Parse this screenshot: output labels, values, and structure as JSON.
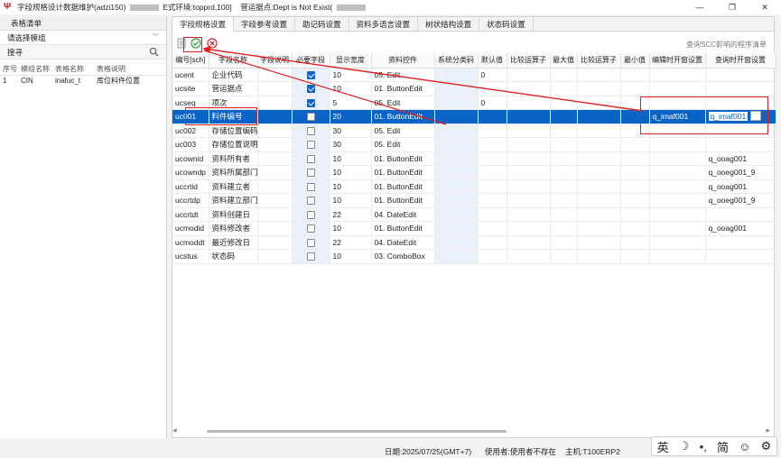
{
  "window": {
    "title_part1": "字段规格设计数据维护(adzi150)",
    "title_part2": "E式环境:topprd,100]",
    "title_part3": "营运据点:Dept is Not Exist(",
    "minimize": "—",
    "maximize": "❐",
    "close": "✕"
  },
  "left": {
    "header": "表格清单",
    "select_placeholder": "请选择模组",
    "search_label": "搜寻",
    "columns": [
      "序号",
      "模组名称",
      "表格名称",
      "表格说明"
    ],
    "rows": [
      {
        "seq": "1",
        "module": "CIN",
        "table": "inafuc_t",
        "desc": "库位料件位置"
      }
    ]
  },
  "tabs": [
    "字段规格设置",
    "字段参考设置",
    "助记码设置",
    "资料多语言设置",
    "树状结构设置",
    "状态码设置"
  ],
  "toolbar": {
    "scc_link": "查询SCC影响的程序清单"
  },
  "grid": {
    "columns": [
      "编号[sch]",
      "字段名称",
      "字段说明",
      "必要字段",
      "显示宽度",
      "资料控件",
      "系统分类码",
      "默认值",
      "比较运算子",
      "最大值",
      "比较运算子",
      "最小值",
      "编辑时开窗设置",
      "查询时开窗设置"
    ],
    "rows": [
      {
        "id": "ucent",
        "name": "企业代码",
        "req": true,
        "width": "10",
        "ctrl": "05. Edit",
        "def": "0",
        "edit_win": "",
        "query_win": ""
      },
      {
        "id": "ucsite",
        "name": "营运据点",
        "req": true,
        "width": "10",
        "ctrl": "01. ButtonEdit",
        "def": "",
        "edit_win": "",
        "query_win": ""
      },
      {
        "id": "ucseq",
        "name": "项次",
        "req": true,
        "width": "5",
        "ctrl": "05. Edit",
        "def": "0",
        "edit_win": "",
        "query_win": ""
      },
      {
        "id": "uc001",
        "name": "料件编号",
        "req": false,
        "width": "20",
        "ctrl": "01. ButtonEdit",
        "def": "",
        "edit_win": "q_imaf001",
        "query_win": "q_imaf001"
      },
      {
        "id": "uc002",
        "name": "存储位置编码",
        "req": false,
        "width": "30",
        "ctrl": "05. Edit",
        "def": "",
        "edit_win": "",
        "query_win": ""
      },
      {
        "id": "uc003",
        "name": "存储位置说明",
        "req": false,
        "width": "30",
        "ctrl": "05. Edit",
        "def": "",
        "edit_win": "",
        "query_win": ""
      },
      {
        "id": "ucownid",
        "name": "资料所有者",
        "req": false,
        "width": "10",
        "ctrl": "01. ButtonEdit",
        "def": "",
        "edit_win": "",
        "query_win": "q_ooag001"
      },
      {
        "id": "ucowndp",
        "name": "资料所属部门",
        "req": false,
        "width": "10",
        "ctrl": "01. ButtonEdit",
        "def": "",
        "edit_win": "",
        "query_win": "q_ooeg001_9"
      },
      {
        "id": "uccrtid",
        "name": "资料建立者",
        "req": false,
        "width": "10",
        "ctrl": "01. ButtonEdit",
        "def": "",
        "edit_win": "",
        "query_win": "q_ooag001"
      },
      {
        "id": "uccrtdp",
        "name": "资料建立部门",
        "req": false,
        "width": "10",
        "ctrl": "01. ButtonEdit",
        "def": "",
        "edit_win": "",
        "query_win": "q_ooeg001_9"
      },
      {
        "id": "uccrtdt",
        "name": "资料创建日",
        "req": false,
        "width": "22",
        "ctrl": "04. DateEdit",
        "def": "",
        "edit_win": "",
        "query_win": ""
      },
      {
        "id": "ucmodid",
        "name": "资料修改者",
        "req": false,
        "width": "10",
        "ctrl": "01. ButtonEdit",
        "def": "",
        "edit_win": "",
        "query_win": "q_ooag001"
      },
      {
        "id": "ucmoddt",
        "name": "最近修改日",
        "req": false,
        "width": "22",
        "ctrl": "04. DateEdit",
        "def": "",
        "edit_win": "",
        "query_win": ""
      },
      {
        "id": "ucstus",
        "name": "状态码",
        "req": false,
        "width": "10",
        "ctrl": "03. ComboBox",
        "def": "",
        "edit_win": "",
        "query_win": ""
      }
    ]
  },
  "status": {
    "date": "日期:2025/07/25(GMT+7)",
    "user": "使用者:使用者不存在",
    "host": "主机:T100ERP2"
  },
  "ime": {
    "lang": "英",
    "moon": "☽",
    "punct": "•,",
    "simp": "简",
    "emoji": "☺",
    "gear": "⚙"
  },
  "colors": {
    "selected_row": "#0a64c8",
    "annotation_red": "#e02020",
    "check_blue": "#1565c0"
  }
}
